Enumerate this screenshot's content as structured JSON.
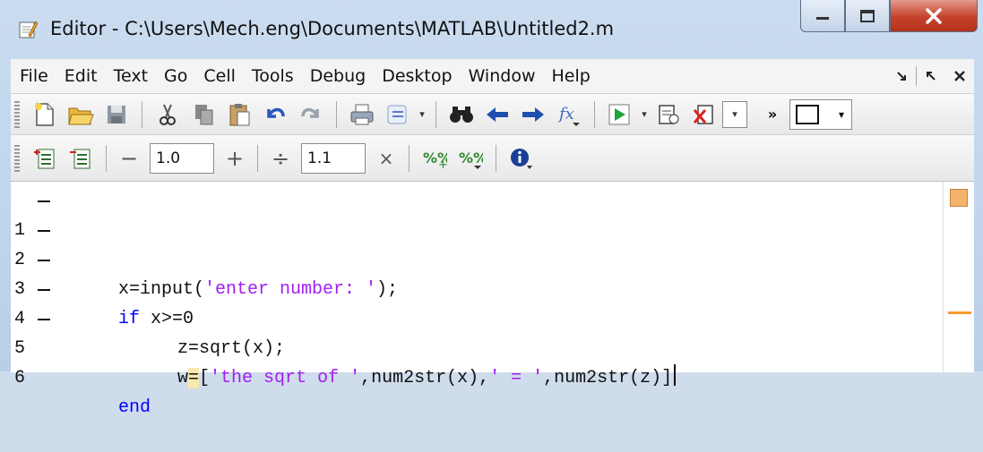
{
  "window": {
    "title": "Editor - C:\\Users\\Mech.eng\\Documents\\MATLAB\\Untitled2.m"
  },
  "menu": {
    "items": [
      "File",
      "Edit",
      "Text",
      "Go",
      "Cell",
      "Tools",
      "Debug",
      "Desktop",
      "Window",
      "Help"
    ]
  },
  "toolbar2": {
    "minus_label": "−",
    "cell_step_value": "1.0",
    "plus_label": "+",
    "divide_label": "÷",
    "cell_scale_value": "1.1",
    "times_label": "×"
  },
  "editor": {
    "lines": [
      {
        "num": "1",
        "breakpoint": true
      },
      {
        "num": "2",
        "breakpoint": true
      },
      {
        "num": "3",
        "breakpoint": true
      },
      {
        "num": "4",
        "breakpoint": true
      },
      {
        "num": "5",
        "breakpoint": true
      },
      {
        "num": "6",
        "breakpoint": false
      }
    ],
    "code": {
      "l1_a": "x=input(",
      "l1_str": "'enter number: '",
      "l1_b": ");",
      "l2_kw": "if",
      "l2_b": " x>=0",
      "l3": "z=sqrt(x);",
      "l4_a": "w",
      "l4_eq": "=",
      "l4_b": "[",
      "l4_s1": "'the sqrt of '",
      "l4_c": ",num2str(x),",
      "l4_s2": "' = '",
      "l4_d": ",num2str(z)]",
      "l5_kw": "end"
    }
  },
  "colors": {
    "keyword": "#0000ff",
    "string": "#a020f0",
    "warning_marker": "#f39c33"
  }
}
